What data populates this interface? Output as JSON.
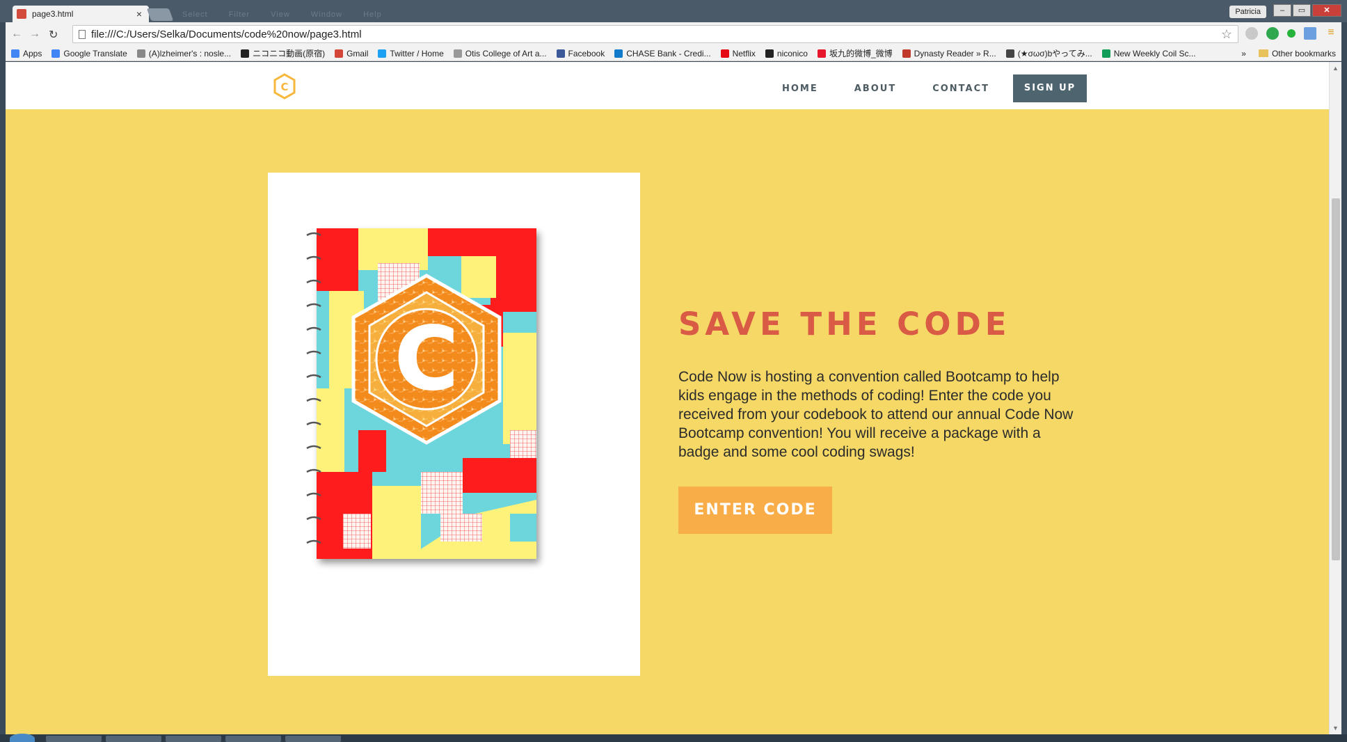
{
  "browser": {
    "tab_title": "page3.html",
    "tab_close": "×",
    "menu_ghost": [
      "Select",
      "Filter",
      "View",
      "Window",
      "Help"
    ],
    "user": "Patricia",
    "window_controls": {
      "minimize": "–",
      "maximize": "▭",
      "close": "✕"
    },
    "nav": {
      "back": "←",
      "forward": "→",
      "reload": "↻"
    },
    "url": "file:///C:/Users/Selka/Documents/code%20now/page3.html",
    "star": "☆",
    "bookmarks": [
      {
        "label": "Apps",
        "icon": "apps-grid-icon",
        "color": "#4285f4"
      },
      {
        "label": "Google Translate",
        "icon": "translate-icon",
        "color": "#4285f4"
      },
      {
        "label": "(A)lzheimer's : nosle...",
        "icon": "reddit-icon",
        "color": "#888888"
      },
      {
        "label": "ニコニコ動画(原宿)",
        "icon": "niconico-icon",
        "color": "#222222"
      },
      {
        "label": "Gmail",
        "icon": "gmail-icon",
        "color": "#d44638"
      },
      {
        "label": "Twitter / Home",
        "icon": "twitter-icon",
        "color": "#1da1f2"
      },
      {
        "label": "Otis College of Art a...",
        "icon": "page-icon",
        "color": "#999999"
      },
      {
        "label": "Facebook",
        "icon": "facebook-icon",
        "color": "#3b5998"
      },
      {
        "label": "CHASE Bank - Credi...",
        "icon": "chase-icon",
        "color": "#117aca"
      },
      {
        "label": "Netflix",
        "icon": "netflix-icon",
        "color": "#e50914"
      },
      {
        "label": "niconico",
        "icon": "niconico-icon",
        "color": "#222222"
      },
      {
        "label": "坂九的微博_微博",
        "icon": "weibo-icon",
        "color": "#e6162d"
      },
      {
        "label": "Dynasty Reader » R...",
        "icon": "dynasty-icon",
        "color": "#c0392b"
      },
      {
        "label": "(★σωσ)bやってみ...",
        "icon": "tv-icon",
        "color": "#444444"
      },
      {
        "label": "New Weekly Coil Sc...",
        "icon": "sheets-icon",
        "color": "#0f9d58"
      }
    ],
    "bookmarks_more": "»",
    "other_bookmarks": "Other bookmarks"
  },
  "site": {
    "nav": {
      "home": "HOME",
      "about": "ABOUT",
      "contact": "CONTACT",
      "signup": "SIGN UP"
    },
    "headline": "SAVE THE CODE",
    "body": "Code Now is hosting a convention called Bootcamp to help kids engage in the methods of coding! Enter the code you received from your codebook to attend our annual Code Now Bootcamp convention! You will receive a package with a badge and some cool coding swags!",
    "cta": "ENTER CODE",
    "logo_letter": "C",
    "notebook_letter": "C"
  },
  "colors": {
    "background": "#f5d866",
    "headline": "#d95a45",
    "cta": "#f9ad48",
    "signup": "#4e6570",
    "nav_text": "#4d5b63"
  }
}
